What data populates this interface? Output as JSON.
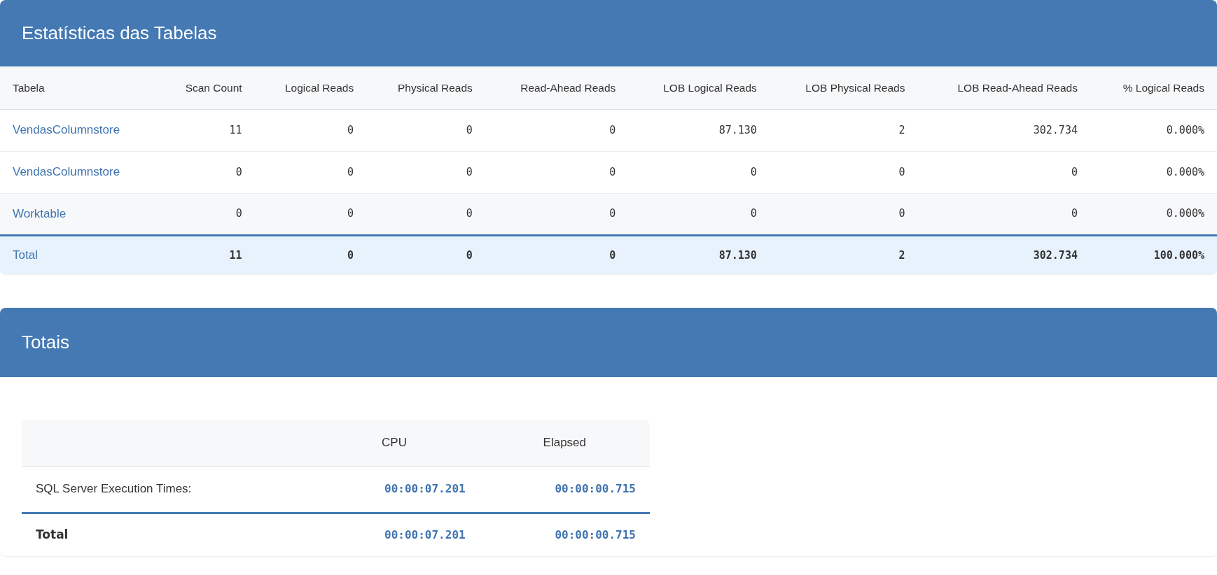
{
  "table_statistics": {
    "title": "Estatísticas das Tabelas",
    "columns": [
      "Tabela",
      "Scan Count",
      "Logical Reads",
      "Physical Reads",
      "Read-Ahead Reads",
      "LOB Logical Reads",
      "LOB Physical Reads",
      "LOB Read-Ahead Reads",
      "% Logical Reads"
    ],
    "rows": [
      {
        "table": "VendasColumnstore",
        "values": [
          "11",
          "0",
          "0",
          "0",
          "87.130",
          "2",
          "302.734",
          "0.000%"
        ]
      },
      {
        "table": "VendasColumnstore",
        "values": [
          "0",
          "0",
          "0",
          "0",
          "0",
          "0",
          "0",
          "0.000%"
        ]
      },
      {
        "table": "Worktable",
        "values": [
          "0",
          "0",
          "0",
          "0",
          "0",
          "0",
          "0",
          "0.000%"
        ]
      }
    ],
    "total": {
      "label": "Total",
      "values": [
        "11",
        "0",
        "0",
        "0",
        "87.130",
        "2",
        "302.734",
        "100.000%"
      ]
    }
  },
  "totals": {
    "title": "Totais",
    "columns": [
      "CPU",
      "Elapsed"
    ],
    "rows": [
      {
        "label": "SQL Server Execution Times:",
        "values": [
          "00:00:07.201",
          "00:00:00.715"
        ]
      }
    ],
    "total": {
      "label": "Total",
      "values": [
        "00:00:07.201",
        "00:00:00.715"
      ]
    }
  }
}
